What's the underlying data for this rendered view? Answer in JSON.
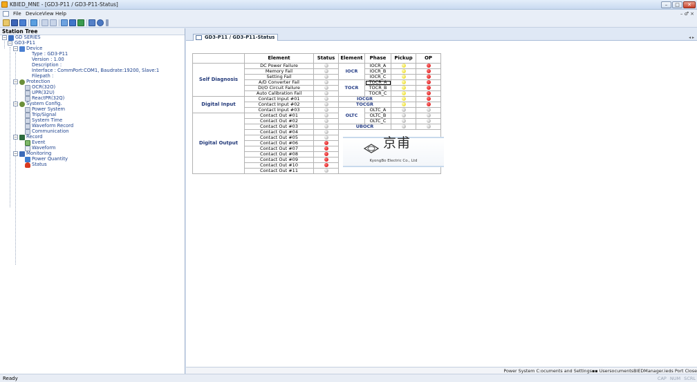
{
  "window": {
    "title": "KBIED_MNE - [GD3-P11 / GD3-P11-Status]",
    "min": "–",
    "max": "□",
    "close": "✕"
  },
  "menu": {
    "file": "File",
    "device": "Device",
    "view": "View",
    "help": "Help",
    "mdi_controls": "– ♂ ×"
  },
  "station_tree": {
    "header": "Station Tree",
    "root": "GD SERIES",
    "device_node": "GD3-P11",
    "device_group": "Device",
    "type": "Type : GD3-P11",
    "version": "Version : 1.00",
    "description": "Description :",
    "interface": "Interface : CommPort:COM1, Baudrate:19200, Slave:1",
    "filepath": "Filepath :",
    "protection": "Protection",
    "ocr": "OCR(32O)",
    "upr": "UPR(32U)",
    "reactpr": "ReactPR(32Q)",
    "system_config": "System Config.",
    "power_system": "Power System",
    "trip_signal": "Trip/Signal",
    "system_time": "System Time",
    "waveform_record": "Waveform Record",
    "communication": "Communication",
    "record": "Record",
    "event": "Event",
    "waveform": "Waveform",
    "monitoring": "Monitoring",
    "power_quantity": "Power Quantity",
    "status": "Status"
  },
  "tab": {
    "label": "GD3-P11 / GD3-P11-Status",
    "nav": "◂ ▸"
  },
  "table": {
    "headers": {
      "element": "Element",
      "status": "Status",
      "element2": "Element",
      "phase": "Phase",
      "pickup": "Pickup",
      "op": "OP"
    },
    "groups": {
      "self_diagnosis": "Self Diagnosis",
      "digital_input": "Digital Input",
      "digital_output": "Digital Output"
    },
    "rows": [
      {
        "name": "DC Power Failure",
        "status": "gray"
      },
      {
        "name": "Memory Fail",
        "status": "gray"
      },
      {
        "name": "Setting Fail",
        "status": "gray"
      },
      {
        "name": "A/D Converter Fail",
        "status": "gray"
      },
      {
        "name": "DI/O Circuit Failure",
        "status": "gray"
      },
      {
        "name": "Auto Calibration Fail",
        "status": "gray"
      },
      {
        "name": "Contact Input #01",
        "status": "gray"
      },
      {
        "name": "Contact Input #02",
        "status": "gray"
      },
      {
        "name": "Contact Input #03",
        "status": "gray"
      },
      {
        "name": "Contact Out #01",
        "status": "gray"
      },
      {
        "name": "Contact Out #02",
        "status": "gray"
      },
      {
        "name": "Contact Out #03",
        "status": "gray"
      },
      {
        "name": "Contact Out #04",
        "status": "gray"
      },
      {
        "name": "Contact Out #05",
        "status": "gray"
      },
      {
        "name": "Contact Out #06",
        "status": "red"
      },
      {
        "name": "Contact Out #07",
        "status": "red"
      },
      {
        "name": "Contact Out #08",
        "status": "red"
      },
      {
        "name": "Contact Out #09",
        "status": "red"
      },
      {
        "name": "Contact Out #10",
        "status": "red"
      },
      {
        "name": "Contact Out #11",
        "status": "gray"
      }
    ],
    "elements": {
      "iocr": "IOCR",
      "tocr": "TOCR",
      "iocgr": "IOCGR",
      "tocgr": "TOCGR",
      "oltc": "OLTC",
      "ubocr": "UBOCR"
    },
    "phases": [
      {
        "label": "IOCR_A",
        "pickup": "yellow",
        "op": "red"
      },
      {
        "label": "IOCR_B",
        "pickup": "yellow",
        "op": "red"
      },
      {
        "label": "IOCR_C",
        "pickup": "yellow",
        "op": "red"
      },
      {
        "label": "TOCR_A",
        "pickup": "yellow",
        "op": "red"
      },
      {
        "label": "TOCR_B",
        "pickup": "yellow",
        "op": "red"
      },
      {
        "label": "TOCR_C",
        "pickup": "yellow",
        "op": "red"
      },
      {
        "label": "",
        "pickup": "yellow",
        "op": "red"
      },
      {
        "label": "",
        "pickup": "yellow",
        "op": "red"
      },
      {
        "label": "OLTC_A",
        "pickup": "gray",
        "op": "gray"
      },
      {
        "label": "OLTC_B",
        "pickup": "gray",
        "op": "gray"
      },
      {
        "label": "OLTC_C",
        "pickup": "gray",
        "op": "gray"
      },
      {
        "label": "",
        "pickup": "gray",
        "op": "gray"
      }
    ],
    "logo": {
      "chars": "京甫",
      "company": "KyongBo Electric Co., Ltd"
    }
  },
  "footer": {
    "text": "Power System   C:ocuments and Settings▪▪ UsersocumentsBIEDManager.ieds   Port Close"
  },
  "statusbar": {
    "ready": "Ready",
    "indicators": "CAP NUM SCRL"
  },
  "colors": {
    "led_red": "#d20000",
    "led_yellow": "#e6d400",
    "led_gray": "#9c9c9c",
    "accent": "#233a7a"
  }
}
